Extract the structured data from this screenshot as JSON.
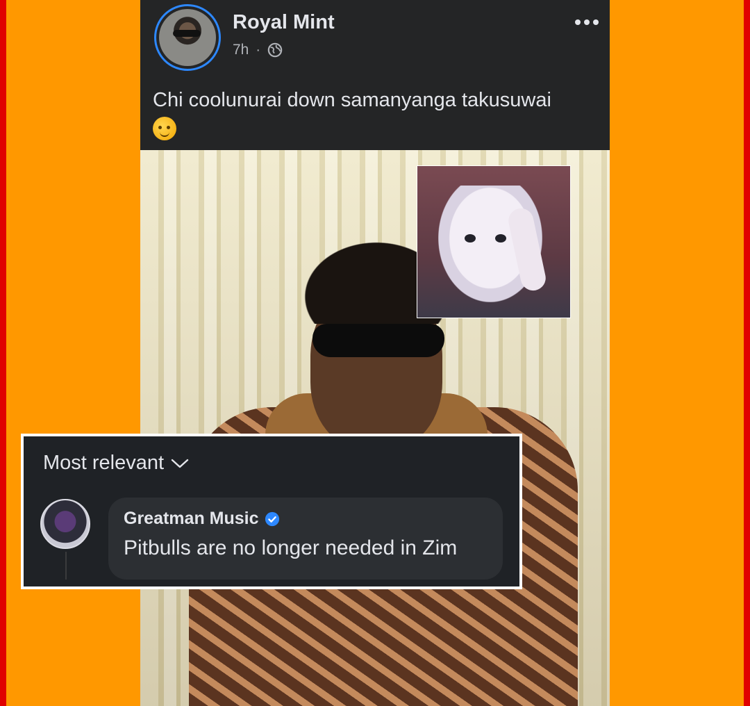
{
  "post": {
    "author": "Royal Mint",
    "time": "7h",
    "separator": "·",
    "privacy_icon": "globe-icon",
    "more_icon": "more-horizontal-icon",
    "text": "Chi coolunurai down samanyanga takusuwai",
    "emoji": "face-holding-back-tears-emoji"
  },
  "comments": {
    "sort_label": "Most relevant",
    "sort_icon": "chevron-down-icon",
    "items": [
      {
        "author": "Greatman Music",
        "verified": true,
        "text": "Pitbulls are no longer needed in Zim"
      }
    ]
  },
  "colors": {
    "background": "#ff9800",
    "border": "#e00000",
    "post_bg": "#242526",
    "accent": "#2d88ff",
    "text": "#e4e6eb",
    "muted": "#b0b3b8"
  }
}
